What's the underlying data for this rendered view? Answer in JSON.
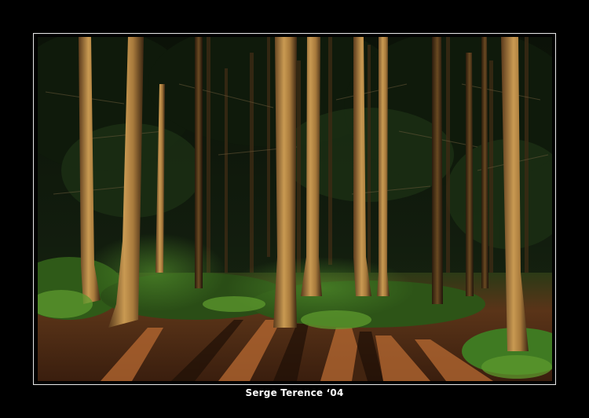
{
  "photo": {
    "subject": "forest",
    "colors": {
      "background": "#000000",
      "frame": "#e8e8e8",
      "trunk_lit": "#c99a52",
      "trunk_dark": "#5a3a1c",
      "foliage": "#1f3b1a",
      "grass": "#3f7a22",
      "ground": "#7a3f1a"
    }
  },
  "caption": {
    "text": "Serge Terence ‘04"
  }
}
